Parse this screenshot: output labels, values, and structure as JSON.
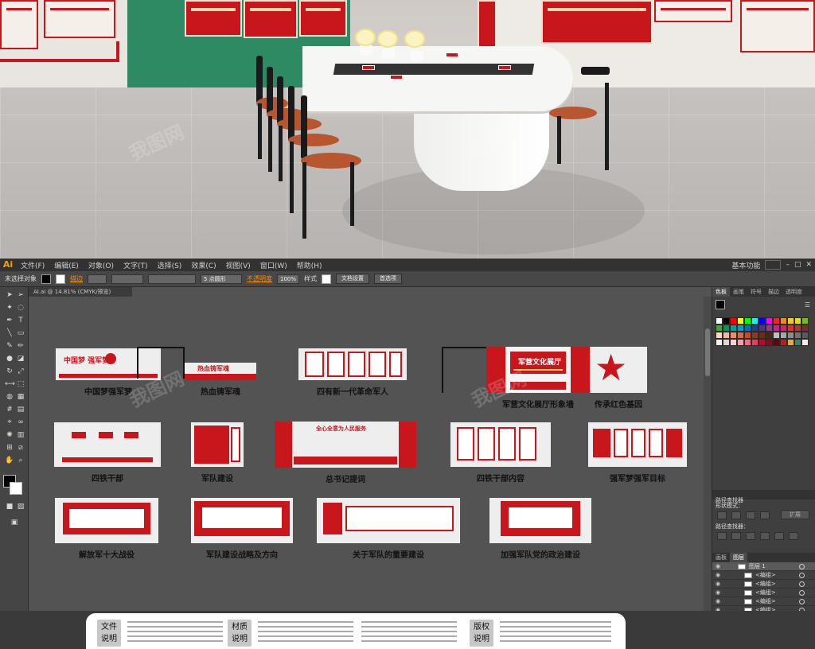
{
  "render": {
    "description_alt": "",
    "accent": "#c8161d"
  },
  "menubar": {
    "logo": "Ai",
    "items": [
      "文件(F)",
      "编辑(E)",
      "对象(O)",
      "文字(T)",
      "选择(S)",
      "效果(C)",
      "视图(V)",
      "窗口(W)",
      "帮助(H)"
    ],
    "workspace": "基本功能"
  },
  "control_bar": {
    "selection": "未选择对象",
    "stroke_label": "描边",
    "stroke_value": "",
    "points_value": "5 点圆形",
    "opacity_label": "不透明度",
    "opacity_value": "100%",
    "style_label": "样式",
    "doc_setup": "文档设置",
    "prefs": "首选项"
  },
  "doc_tab": {
    "title": "AI.ai @ 14.81% (CMYK/预览)"
  },
  "artboards": [
    {
      "label": "中国梦强军梦"
    },
    {
      "label": "热血铸军魂"
    },
    {
      "label": "四有新一代革命军人"
    },
    {
      "label": "军营文化展厅形象墙"
    },
    {
      "label": "传承红色基因"
    },
    {
      "label": "四铁干部"
    },
    {
      "label": "军队建设"
    },
    {
      "label": "总书记提词"
    },
    {
      "label": "四铁干部内容"
    },
    {
      "label": "强军梦强军目标"
    },
    {
      "label": "解放军十大战役"
    },
    {
      "label": "军队建设战略及方向"
    },
    {
      "label": "关于军队的重要建设"
    },
    {
      "label": "加强军队党的政治建设"
    }
  ],
  "art_text": {
    "a1": "中国梦 强军梦",
    "a2": "热血铸军魂",
    "a4_title": "军营文化展厅",
    "a8_title": "全心全意为人民服务"
  },
  "notes": {
    "file_head_1": "文件",
    "file_head_2": "说明",
    "material_head_1": "材质",
    "material_head_2": "说明",
    "copyright_head_1": "版权",
    "copyright_head_2": "说明"
  },
  "panels": {
    "tabs": [
      "色板",
      "画笔",
      "符号",
      "描边",
      "透明度",
      "符号"
    ],
    "pathfinder_title": "路径查找器",
    "shape_mode": "形状模式：",
    "expand": "扩展",
    "pathfinder_label": "路径查找器：",
    "layers_tabs": [
      "画板",
      "图层"
    ],
    "layers": [
      {
        "name": "图层 1",
        "selected": true
      },
      {
        "name": "<编组>",
        "selected": false
      },
      {
        "name": "<编组>",
        "selected": false
      },
      {
        "name": "<编组>",
        "selected": false
      },
      {
        "name": "<编组>",
        "selected": false
      },
      {
        "name": "<编组>",
        "selected": false
      },
      {
        "name": "<编组>",
        "selected": false
      },
      {
        "name": "<编组>",
        "selected": false
      },
      {
        "name": "<编组>",
        "selected": false
      }
    ]
  },
  "swatch_colors": [
    "#ffffff",
    "#000000",
    "#ff0000",
    "#ffff00",
    "#00ff00",
    "#00ffff",
    "#0000ff",
    "#ff00ff",
    "#e5262a",
    "#f08a1d",
    "#f7c62f",
    "#d6e01d",
    "#78b82a",
    "#3aaa35",
    "#00975a",
    "#00a19a",
    "#00a0c6",
    "#0071bc",
    "#1d3f94",
    "#5b2c86",
    "#8d3b8b",
    "#c9218e",
    "#e6186c",
    "#e52d2d",
    "#b3342f",
    "#7b2e2e",
    "#f8d6c8",
    "#f5b5a0",
    "#e98e6f",
    "#d96a45",
    "#c44c2c",
    "#8e3a22",
    "#6a2d1c",
    "#4b241a",
    "#bfbfbf",
    "#a6a6a6",
    "#8c8c8c",
    "#737373",
    "#595959",
    "#f2f2f2",
    "#d9d9d9",
    "#ffccd5",
    "#ff99aa",
    "#ff6680",
    "#ff3355",
    "#cc0022",
    "#990019",
    "#660011",
    "#c8161d",
    "#e9a83a",
    "#2e8a63",
    "#fde8e8"
  ],
  "watermark": "我图网"
}
